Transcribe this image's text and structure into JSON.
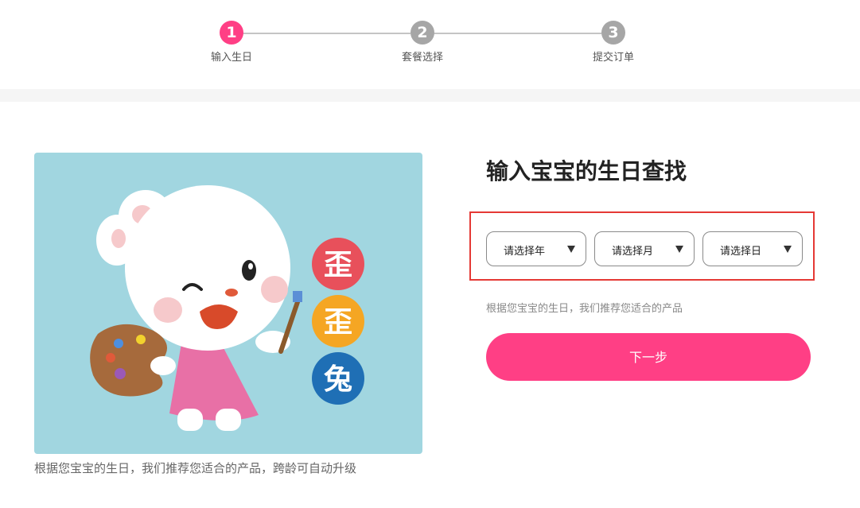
{
  "colors": {
    "accent": "#ff3f85",
    "step_inactive": "#a6a6a6",
    "highlight_border": "#e53935",
    "illustration_bg": "#a1d6e0"
  },
  "steps": [
    {
      "number": "1",
      "label": "输入生日",
      "active": true
    },
    {
      "number": "2",
      "label": "套餐选择",
      "active": false
    },
    {
      "number": "3",
      "label": "提交订单",
      "active": false
    }
  ],
  "illustration": {
    "brand_chars": [
      "歪",
      "歪",
      "兔"
    ],
    "caption": "根据您宝宝的生日，我们推荐您适合的产品，跨龄可自动升级"
  },
  "form": {
    "title": "输入宝宝的生日查找",
    "selects": {
      "year": "请选择年",
      "month": "请选择月",
      "day": "请选择日"
    },
    "hint": "根据您宝宝的生日，我们推荐您适合的产品",
    "next_label": "下一步"
  }
}
